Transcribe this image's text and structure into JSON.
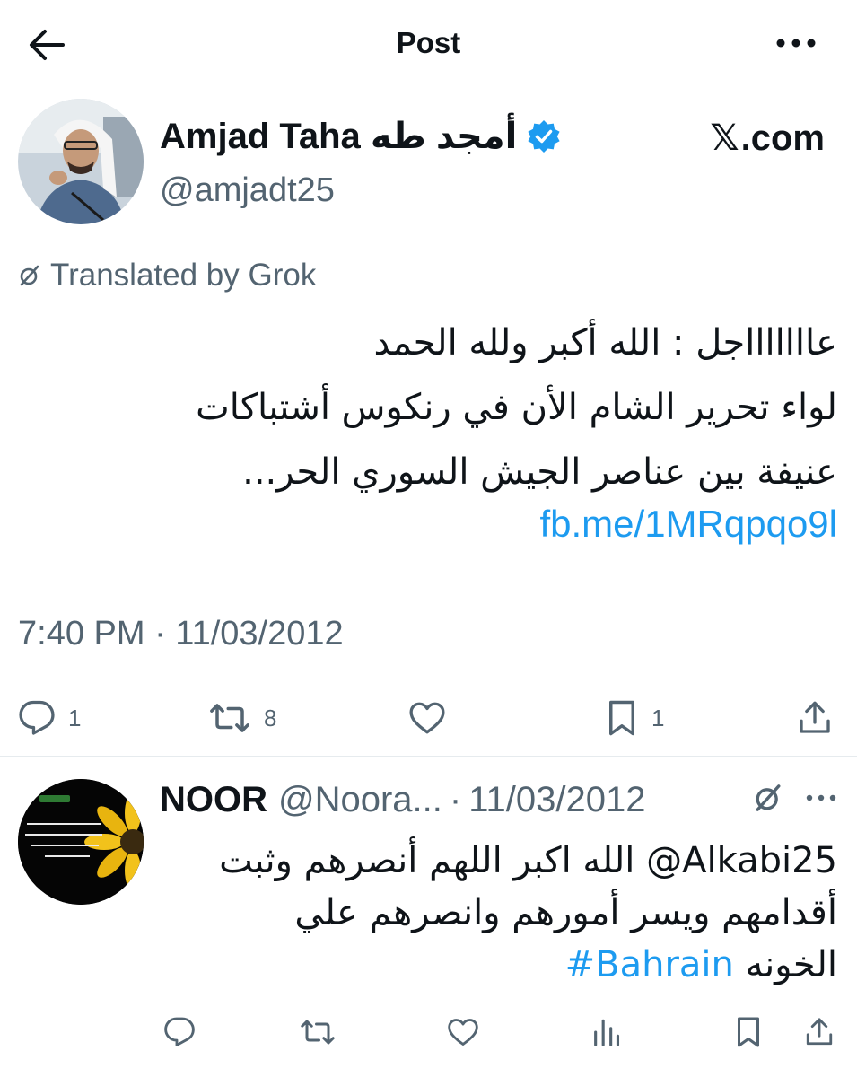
{
  "header": {
    "title": "Post",
    "back_icon": "back-arrow-icon",
    "more_icon": "more-horizontal-icon"
  },
  "tweet": {
    "author_name": "Amjad Taha أمجد طه",
    "handle": "@amjadt25",
    "verified": true,
    "source_x": "𝕏",
    "source_domain": ".com",
    "translated_label": "Translated by Grok",
    "text_lines": [
      "عاااااااجل : الله أكبر ولله الحمد",
      "لواء تحرير الشام الأن في رنكوس أشتباكات",
      "عنيفة بين عناصر الجيش السوري الحر..."
    ],
    "link": "fb.me/1MRqpqo9l",
    "timestamp": "7:40 PM · 11/03/2012",
    "stats": {
      "replies": "1",
      "reposts": "8",
      "likes": "",
      "bookmarks": "1"
    }
  },
  "reply": {
    "name": "NOOR",
    "handle": "@Noora...",
    "dot": "·",
    "date": "11/03/2012",
    "text_lines": [
      "Alkabi25@ الله اكبر اللهم أنصرهم وثبت",
      "أقدامهم ويسر أمورهم وانصرهم علي"
    ],
    "text_last_prefix": "الخونه",
    "hashtag": "#Bahrain"
  },
  "colors": {
    "accent": "#1d9bf0",
    "text": "#0f1419",
    "muted": "#536471",
    "divider": "#e6ebee"
  }
}
